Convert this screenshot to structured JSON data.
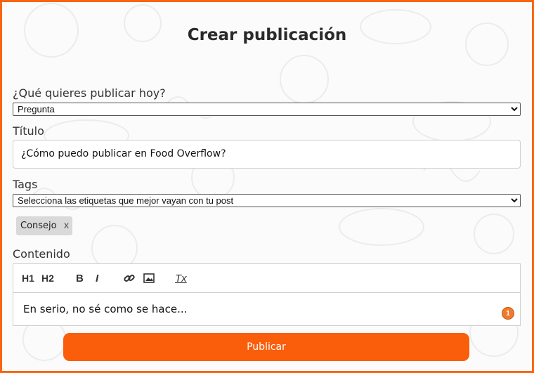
{
  "form": {
    "heading": "Crear publicación",
    "type_label": "¿Qué quieres publicar hoy?",
    "type_selected": "Pregunta",
    "title_label": "Título",
    "title_value": "¿Cómo puedo publicar en Food Overflow?",
    "tags_label": "Tags",
    "tags_placeholder": "Selecciona las etiquetas que mejor vayan con tu post",
    "tags": [
      {
        "label": "Consejo",
        "remove": "x"
      }
    ],
    "content_label": "Contenido",
    "content_value": "En serio, no sé como se hace...",
    "editor_toolbar": [
      {
        "name": "heading-1-icon",
        "text": "H1"
      },
      {
        "name": "heading-2-icon",
        "text": "H2"
      },
      {
        "name": "bold-icon",
        "text": "B"
      },
      {
        "name": "italic-icon",
        "text": "I"
      },
      {
        "name": "link-icon"
      },
      {
        "name": "image-icon"
      },
      {
        "name": "clear-format-icon",
        "text": "Tx"
      }
    ],
    "notification_count": "1",
    "submit_label": "Publicar"
  },
  "colors": {
    "accent": "#fb5e0a",
    "border": "#fb6410",
    "chip_bg": "#d9d9d9"
  }
}
